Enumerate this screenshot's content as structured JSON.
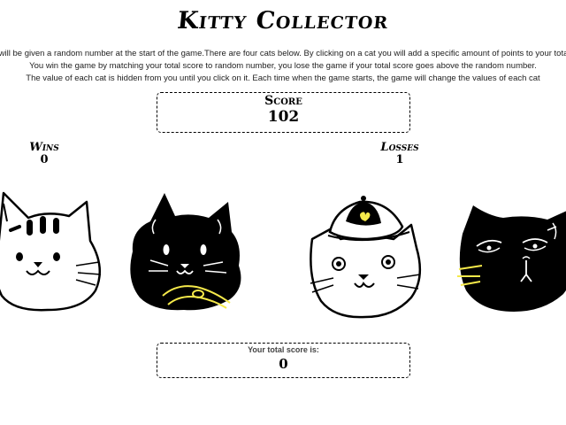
{
  "game": {
    "title": "Kitty Collector",
    "instructions": [
      "You will be given a random number at the start of the game.There are four cats below. By clicking on a cat you will add a specific amount of points to your total score",
      "You win the game by matching your total score to random number, you lose the game if your total score goes above the random number.",
      "The value of each cat is hidden from you until you click on it. Each time when the game starts, the game will change the values of each cat"
    ]
  },
  "score": {
    "label": "Score",
    "value": "102"
  },
  "wins": {
    "label": "Wins",
    "value": "0"
  },
  "losses": {
    "label": "Losses",
    "value": "1"
  },
  "cats": [
    {
      "name": "white-striped-cat"
    },
    {
      "name": "black-whisker-cat"
    },
    {
      "name": "cap-wearing-cat"
    },
    {
      "name": "grumpy-black-cat"
    }
  ],
  "total": {
    "label": "Your total score is:",
    "value": "0"
  },
  "colors": {
    "accent_yellow": "#f5e94a",
    "ink": "#000000",
    "paper": "#ffffff"
  }
}
